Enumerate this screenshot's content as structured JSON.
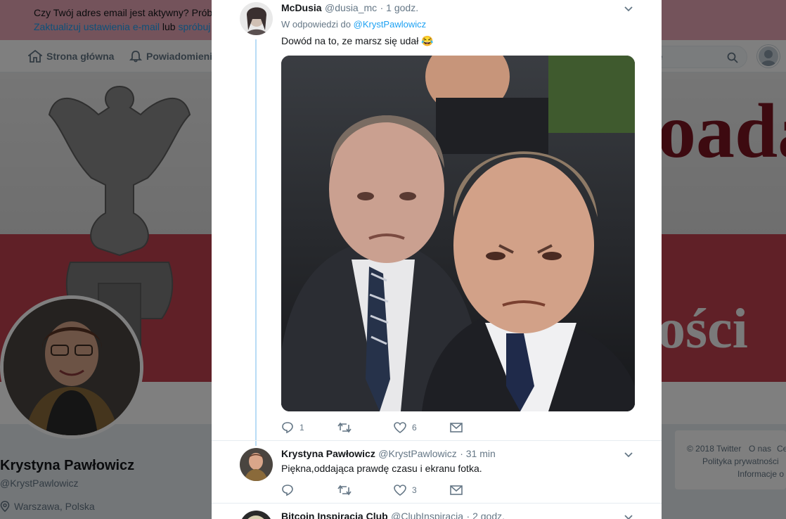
{
  "notice": {
    "line1": "Czy Twój adres email jest aktywny? Próbo",
    "line2_link1": "Zaktualizuj ustawienia e-mail",
    "line2_mid": " lub ",
    "line2_link2": "spróbuj"
  },
  "nav": {
    "home": "Strona główna",
    "notifications": "Powiadomienia",
    "search_placeholder": "rze"
  },
  "cover": {
    "text_top": "oada",
    "text_bottom": "ości"
  },
  "profile": {
    "name": "Krystyna Pawłowicz",
    "handle": "@KrystPawlowicz",
    "location": "Warszawa, Polska"
  },
  "footer": {
    "copyright": "© 2018 Twitter",
    "about": "O nas",
    "center": "Ce",
    "privacy": "Polityka prywatności",
    "info": "Informacje o"
  },
  "tweets": [
    {
      "name": "McDusia",
      "handle": "@dusia_mc",
      "time": "· 1 godz.",
      "reply_prefix": "W odpowiedzi do ",
      "reply_to": "@KrystPawlowicz",
      "text": "Dowód na to, ze marsz się udał 😂",
      "replies": "1",
      "retweets": "",
      "likes": "6"
    },
    {
      "name": "Krystyna Pawłowicz",
      "handle": "@KrystPawlowicz",
      "time": "· 31 min",
      "text": "Piękna,oddająca prawdę czasu i ekranu fotka.",
      "replies": "",
      "retweets": "",
      "likes": "3"
    },
    {
      "name": "Bitcoin Inspiracja Club",
      "handle": "@ClubInspiracja",
      "time": "· 2 godz."
    }
  ],
  "colors": {
    "accent": "#1da1f2",
    "muted": "#657786",
    "thread_line": "#b8dcf5",
    "notice_bg": "#e8a6b6"
  }
}
